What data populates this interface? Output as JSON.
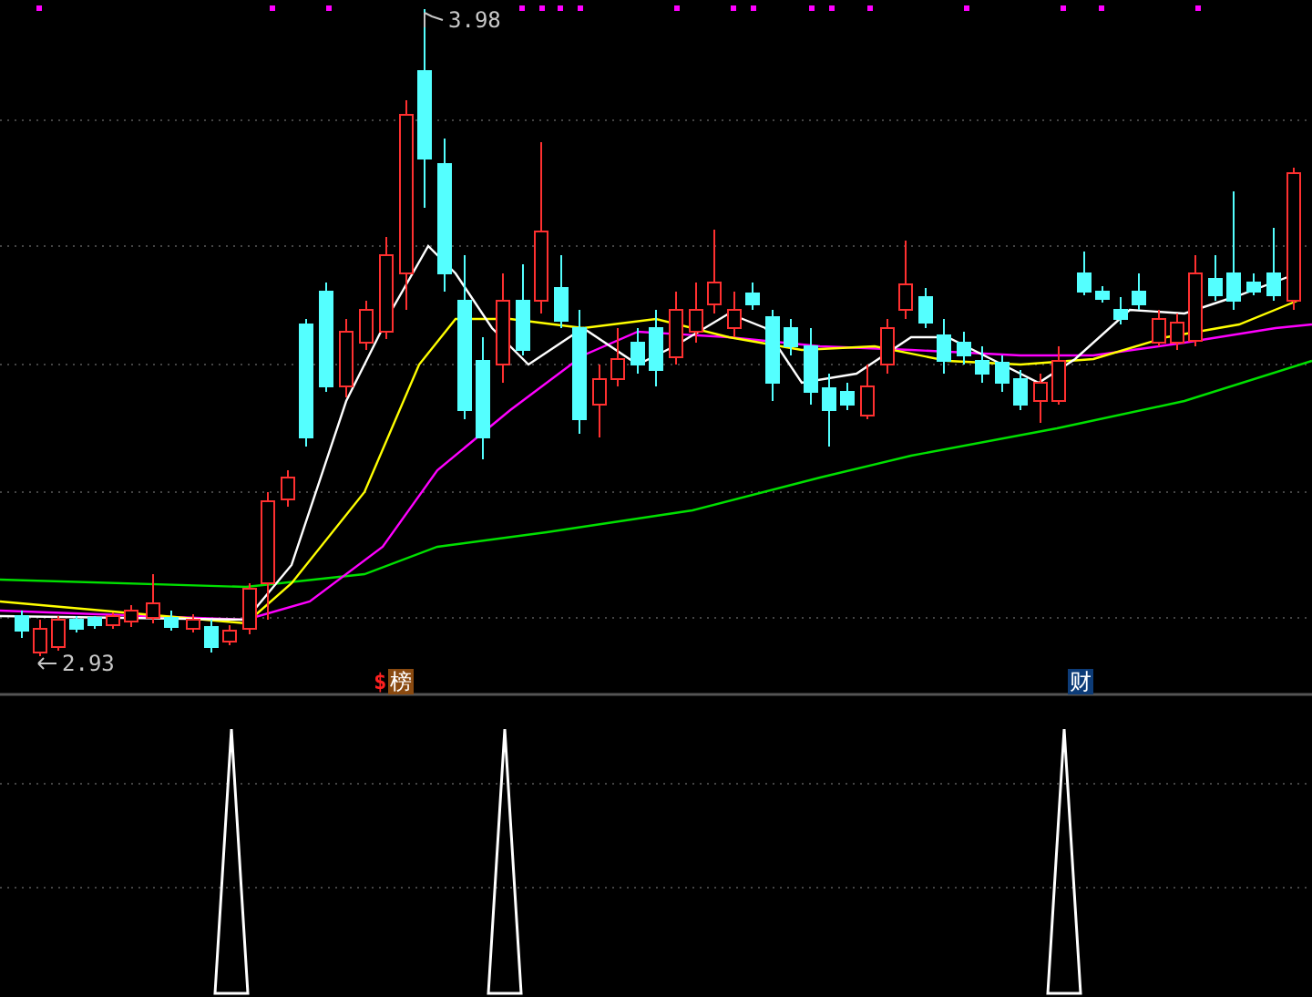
{
  "chart": {
    "high_label": "3.98",
    "low_label": "2.93"
  },
  "signals": [
    {
      "icon": "$",
      "label": "榜",
      "color": "#8a4a10"
    },
    {
      "label": "财",
      "color": "#0d3c78"
    }
  ]
}
